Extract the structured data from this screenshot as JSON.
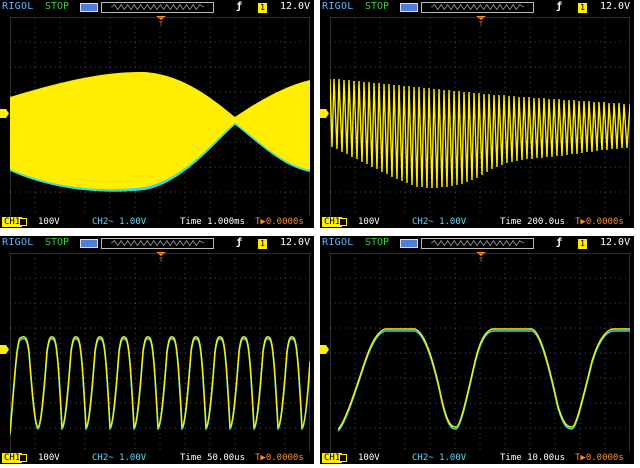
{
  "colors": {
    "ch1": "#ffee00",
    "ch2": "#35d9e0",
    "grid": "#4a4a4a",
    "trigger": "#ff8c1a",
    "brand": "#5fb8ff",
    "status": "#3ad33a"
  },
  "screens": [
    {
      "brand": "RIGOL",
      "status": "STOP",
      "trigger_level": "12.0V",
      "ch1_label": "CH1",
      "ch1_scale": "100V",
      "ch2_info": "CH2~  1.00V",
      "timebase": "Time 1.000ms",
      "trigger_pos": "0.0000s",
      "waveform": "am-envelope"
    },
    {
      "brand": "RIGOL",
      "status": "STOP",
      "trigger_level": "12.0V",
      "ch1_label": "CH1",
      "ch1_scale": "100V",
      "ch2_info": "CH2~  1.00V",
      "timebase": "Time 200.0us",
      "trigger_pos": "0.0000s",
      "waveform": "dense-pulse-train"
    },
    {
      "brand": "RIGOL",
      "status": "STOP",
      "trigger_level": "12.0V",
      "ch1_label": "CH1",
      "ch1_scale": "100V",
      "ch2_info": "CH2~  1.00V",
      "timebase": "Time 50.00us",
      "trigger_pos": "0.0000s",
      "waveform": "pulse-train"
    },
    {
      "brand": "RIGOL",
      "status": "STOP",
      "trigger_level": "12.0V",
      "ch1_label": "CH1",
      "ch1_scale": "100V",
      "ch2_info": "CH2~  1.00V",
      "timebase": "Time 10.00us",
      "trigger_pos": "0.0000s",
      "waveform": "trapezoid"
    }
  ]
}
